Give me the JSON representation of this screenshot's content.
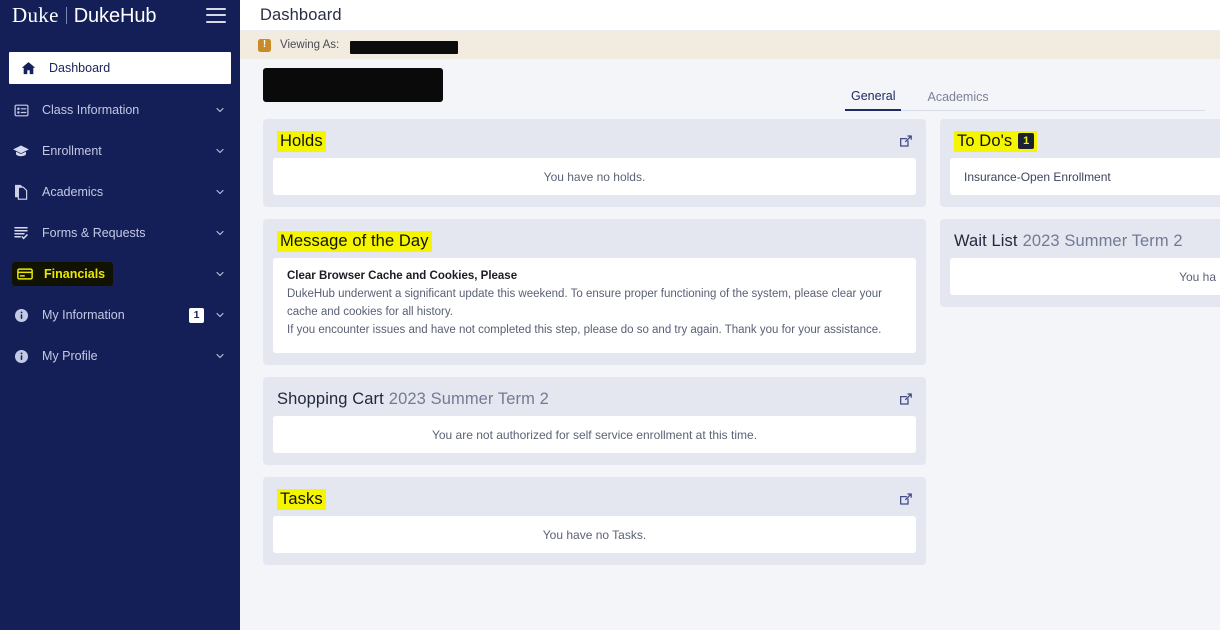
{
  "sidebar": {
    "brand": {
      "primary": "Duke",
      "secondary": "DukeHub"
    },
    "menu_icon": "hamburger-icon",
    "items": [
      {
        "label": "Dashboard",
        "icon": "home-icon",
        "active": true,
        "chevron": false,
        "badge": null,
        "marked": false
      },
      {
        "label": "Class Information",
        "icon": "grid-list-icon",
        "active": false,
        "chevron": true,
        "badge": null,
        "marked": false
      },
      {
        "label": "Enrollment",
        "icon": "graduation-cap-icon",
        "active": false,
        "chevron": true,
        "badge": null,
        "marked": false
      },
      {
        "label": "Academics",
        "icon": "documents-icon",
        "active": false,
        "chevron": true,
        "badge": null,
        "marked": false
      },
      {
        "label": "Forms & Requests",
        "icon": "checklist-icon",
        "active": false,
        "chevron": true,
        "badge": null,
        "marked": false
      },
      {
        "label": "Financials",
        "icon": "credit-card-icon",
        "active": false,
        "chevron": true,
        "badge": null,
        "marked": true
      },
      {
        "label": "My Information",
        "icon": "info-circle-icon",
        "active": false,
        "chevron": true,
        "badge": "1",
        "marked": false
      },
      {
        "label": "My Profile",
        "icon": "info-circle-icon",
        "active": false,
        "chevron": true,
        "badge": null,
        "marked": false
      }
    ]
  },
  "topbar": {
    "title": "Dashboard"
  },
  "viewing_as": {
    "icon": "warning-exclamation-icon",
    "label": "Viewing As:",
    "value_redacted": true
  },
  "student": {
    "name_redacted": true
  },
  "tabs": [
    {
      "label": "General",
      "active": true
    },
    {
      "label": "Academics",
      "active": false
    }
  ],
  "cards": {
    "holds": {
      "title": "Holds",
      "marked": true,
      "expand_icon": "external-link-icon",
      "empty_message": "You have no holds."
    },
    "message_of_the_day": {
      "title": "Message of the Day",
      "marked": true,
      "heading": "Clear Browser Cache and Cookies, Please",
      "paragraph_1": "DukeHub underwent a significant update this weekend. To ensure proper functioning of the system, please clear your cache and cookies for all history.",
      "paragraph_2": "If you encounter issues and have not completed this step, please do so and try again. Thank you for your assistance."
    },
    "shopping_cart": {
      "title": "Shopping Cart",
      "term": "2023 Summer Term 2",
      "marked": false,
      "expand_icon": "external-link-icon",
      "empty_message": "You are not authorized for self service enrollment at this time."
    },
    "tasks": {
      "title": "Tasks",
      "marked": true,
      "expand_icon": "external-link-icon",
      "empty_message": "You have no Tasks."
    },
    "to_dos": {
      "title": "To Do's",
      "marked": true,
      "badge": "1",
      "item_1": "Insurance-Open Enrollment"
    },
    "wait_list": {
      "title": "Wait List",
      "term": "2023 Summer Term 2",
      "marked": false,
      "empty_message_clipped": "You ha"
    }
  },
  "colors": {
    "sidebar_navy": "#141f57",
    "page_background": "#f4f5f9",
    "card_background": "#e4e7f0",
    "panel_white": "#ffffff",
    "highlight_yellow": "#f5f500",
    "warning_amber": "#c98a28",
    "accent_navy": "#1f2a63",
    "redaction_black": "#0a0a0a"
  }
}
